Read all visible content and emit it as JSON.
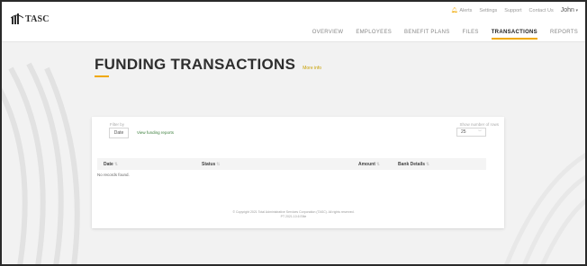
{
  "brand": {
    "name": "TASC"
  },
  "utility_nav": {
    "alerts": "Alerts",
    "settings": "Settings",
    "support": "Support",
    "contact": "Contact Us",
    "user": "John"
  },
  "main_nav": {
    "items": [
      "OVERVIEW",
      "EMPLOYEES",
      "BENEFIT PLANS",
      "FILES",
      "TRANSACTIONS",
      "REPORTS"
    ],
    "active": "TRANSACTIONS"
  },
  "page": {
    "title": "FUNDING TRANSACTIONS",
    "more_info": "More info"
  },
  "filters": {
    "label": "Filter by",
    "date_button": "Date",
    "view_reports": "View funding reports",
    "rows_label": "Show number of rows",
    "rows_value": "25"
  },
  "table": {
    "columns": [
      "Date",
      "Status",
      "Amount",
      "Bank Details"
    ],
    "empty_message": "No records found."
  },
  "footer": {
    "line1": "© Copyright 2021 Total Administrative Services Corporation (TASC). All rights reserved.",
    "line2": "PT 2021.10.6 Elite"
  },
  "colors": {
    "accent": "#f0a800",
    "link": "#3a7d3a",
    "background": "#f2f2f2"
  }
}
